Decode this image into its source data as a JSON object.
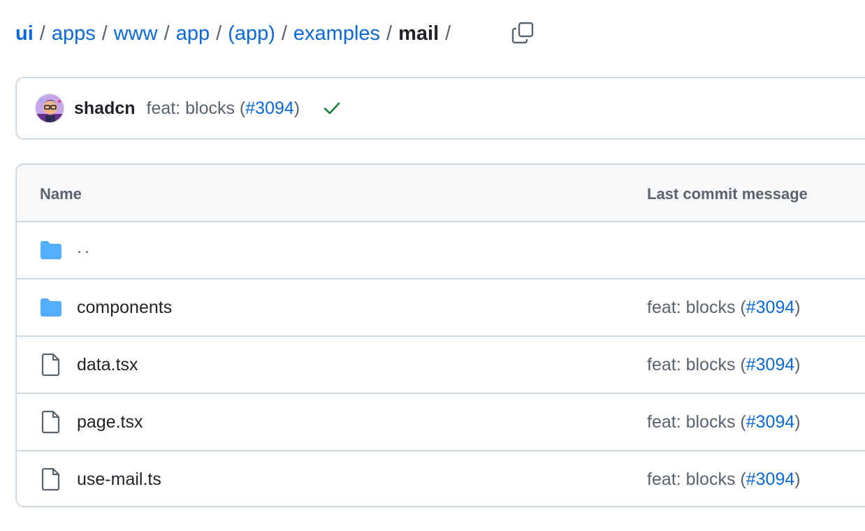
{
  "breadcrumb": {
    "root": "ui",
    "links": [
      "apps",
      "www",
      "app",
      "(app)",
      "examples"
    ],
    "current": "mail",
    "separator": "/"
  },
  "copy_icon": "copy-icon",
  "commit": {
    "author": "shadcn",
    "message_prefix": "feat: blocks (",
    "pr": "#3094",
    "message_suffix": ")",
    "status": "check-icon",
    "status_color": "#1a7f37"
  },
  "table": {
    "headers": {
      "name": "Name",
      "last_commit": "Last commit message"
    },
    "rows": [
      {
        "icon": "folder-icon",
        "name": "..",
        "commit_prefix": "",
        "pr": "",
        "commit_suffix": ""
      },
      {
        "icon": "folder-icon",
        "name": "components",
        "commit_prefix": "feat: blocks (",
        "pr": "#3094",
        "commit_suffix": ")"
      },
      {
        "icon": "file-icon",
        "name": "data.tsx",
        "commit_prefix": "feat: blocks (",
        "pr": "#3094",
        "commit_suffix": ")"
      },
      {
        "icon": "file-icon",
        "name": "page.tsx",
        "commit_prefix": "feat: blocks (",
        "pr": "#3094",
        "commit_suffix": ")"
      },
      {
        "icon": "file-icon",
        "name": "use-mail.ts",
        "commit_prefix": "feat: blocks (",
        "pr": "#3094",
        "commit_suffix": ")"
      }
    ]
  },
  "colors": {
    "link": "#0969da",
    "folder": "#54aeff",
    "border": "#d1d9e0",
    "header_bg": "#f6f8fa",
    "muted": "#59636e"
  }
}
